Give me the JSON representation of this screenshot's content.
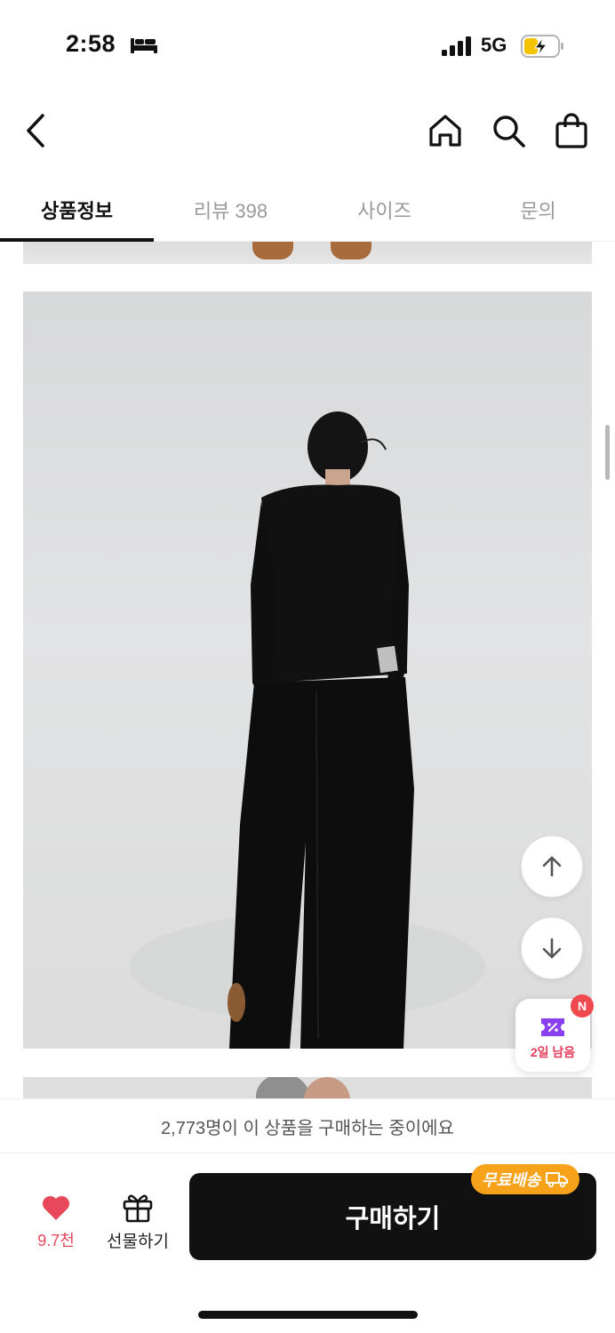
{
  "status_bar": {
    "time": "2:58",
    "network": "5G",
    "icons": [
      "bed-icon",
      "signal-icon",
      "battery-charging-icon"
    ]
  },
  "header": {
    "icons": [
      "back-chevron-icon",
      "home-icon",
      "search-icon",
      "shopping-bag-icon"
    ]
  },
  "tabs": [
    {
      "label": "상품정보",
      "active": true
    },
    {
      "label": "리뷰 398",
      "active": false
    },
    {
      "label": "사이즈",
      "active": false
    },
    {
      "label": "문의",
      "active": false
    }
  ],
  "floating": {
    "icons": [
      "arrow-up-icon",
      "arrow-down-icon",
      "coupon-icon"
    ],
    "coupon_label": "2일 남음",
    "coupon_badge": "N"
  },
  "buyer_banner": "2,773명이 이 상품을 구매하는 중이에요",
  "bottom_bar": {
    "like_count": "9.7천",
    "gift_label": "선물하기",
    "buy_label": "구매하기",
    "free_shipping_label": "무료배송"
  },
  "colors": {
    "accent_red": "#e8485c",
    "buy_button": "#111111",
    "free_shipping_badge": "#f6a21a",
    "coupon_purple": "#8a3ff0"
  }
}
